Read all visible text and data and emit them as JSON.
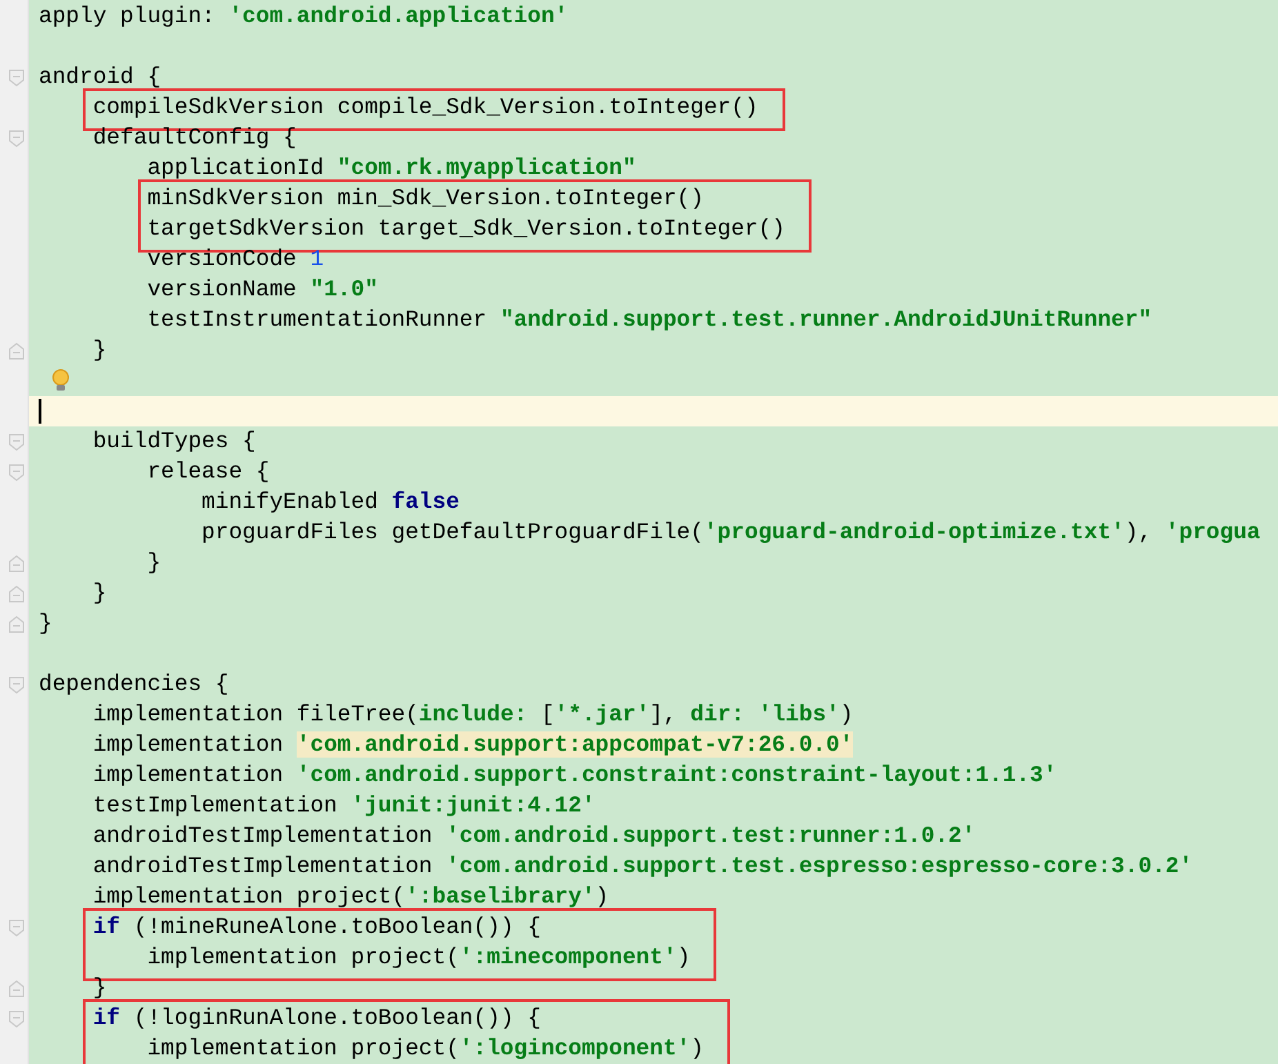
{
  "editor": {
    "blocks": [
      {
        "boxed": false,
        "lines": [
          {
            "tokens": [
              {
                "kind": "plain",
                "text": "apply plugin: "
              },
              {
                "kind": "string",
                "text": "'com.android.application'"
              }
            ]
          },
          {
            "kind": "blank"
          },
          {
            "fold_start": true,
            "tokens": [
              {
                "kind": "plain",
                "text": "android {"
              }
            ]
          }
        ]
      },
      {
        "boxed": true,
        "lines": [
          {
            "tokens": [
              {
                "kind": "plain",
                "text": "    compileSdkVersion compile_Sdk_Version.toInteger()"
              }
            ]
          }
        ]
      },
      {
        "boxed": false,
        "lines": [
          {
            "fold_start": true,
            "tokens": [
              {
                "kind": "plain",
                "text": "    defaultConfig {"
              }
            ]
          },
          {
            "tokens": [
              {
                "kind": "plain",
                "text": "        applicationId "
              },
              {
                "kind": "string",
                "text": "\"com.rk.myapplication\""
              }
            ]
          }
        ]
      },
      {
        "boxed": true,
        "lines": [
          {
            "tokens": [
              {
                "kind": "plain",
                "text": "        minSdkVersion min_Sdk_Version.toInteger()"
              }
            ]
          },
          {
            "tokens": [
              {
                "kind": "plain",
                "text": "        targetSdkVersion target_Sdk_Version.toInteger()"
              }
            ]
          }
        ]
      },
      {
        "boxed": false,
        "lines": [
          {
            "tokens": [
              {
                "kind": "plain",
                "text": "        versionCode "
              },
              {
                "kind": "number",
                "text": "1"
              }
            ]
          },
          {
            "tokens": [
              {
                "kind": "plain",
                "text": "        versionName "
              },
              {
                "kind": "string",
                "text": "\"1.0\""
              }
            ]
          },
          {
            "tokens": [
              {
                "kind": "plain",
                "text": "        testInstrumentationRunner "
              },
              {
                "kind": "string",
                "text": "\"android.support.test.runner.AndroidJUnitRunner\""
              }
            ]
          },
          {
            "fold_end": true,
            "tokens": [
              {
                "kind": "plain",
                "text": "    }"
              }
            ]
          },
          {
            "kind": "blank",
            "hint": true
          },
          {
            "kind": "blank",
            "current": true
          },
          {
            "fold_start": true,
            "tokens": [
              {
                "kind": "plain",
                "text": "    buildTypes {"
              }
            ]
          },
          {
            "fold_start": true,
            "tokens": [
              {
                "kind": "plain",
                "text": "        release {"
              }
            ]
          },
          {
            "tokens": [
              {
                "kind": "plain",
                "text": "            minifyEnabled "
              },
              {
                "kind": "keyword",
                "text": "false"
              }
            ]
          },
          {
            "tokens": [
              {
                "kind": "plain",
                "text": "            proguardFiles getDefaultProguardFile("
              },
              {
                "kind": "string",
                "text": "'proguard-android-optimize.txt'"
              },
              {
                "kind": "plain",
                "text": "), "
              },
              {
                "kind": "string",
                "text": "'progua"
              }
            ]
          },
          {
            "fold_end": true,
            "tokens": [
              {
                "kind": "plain",
                "text": "        }"
              }
            ]
          },
          {
            "fold_end": true,
            "tokens": [
              {
                "kind": "plain",
                "text": "    }"
              }
            ]
          },
          {
            "fold_end": true,
            "tokens": [
              {
                "kind": "plain",
                "text": "}"
              }
            ]
          },
          {
            "kind": "blank"
          },
          {
            "fold_start": true,
            "tokens": [
              {
                "kind": "plain",
                "text": "dependencies {"
              }
            ]
          },
          {
            "tokens": [
              {
                "kind": "plain",
                "text": "    implementation fileTree("
              },
              {
                "kind": "string",
                "text": "include: "
              },
              {
                "kind": "plain",
                "text": "["
              },
              {
                "kind": "string",
                "text": "'*.jar'"
              },
              {
                "kind": "plain",
                "text": "], "
              },
              {
                "kind": "string",
                "text": "dir: 'libs'"
              },
              {
                "kind": "plain",
                "text": ")"
              }
            ]
          },
          {
            "tokens": [
              {
                "kind": "plain",
                "text": "    implementation "
              },
              {
                "kind": "string",
                "text": "'com.android.support:appcompat-v7:26.0.0'",
                "marked": true
              }
            ]
          },
          {
            "tokens": [
              {
                "kind": "plain",
                "text": "    implementation "
              },
              {
                "kind": "string",
                "text": "'com.android.support.constraint:constraint-layout:1.1.3'"
              }
            ]
          },
          {
            "tokens": [
              {
                "kind": "plain",
                "text": "    testImplementation "
              },
              {
                "kind": "string",
                "text": "'junit:junit:4.12'"
              }
            ]
          },
          {
            "tokens": [
              {
                "kind": "plain",
                "text": "    androidTestImplementation "
              },
              {
                "kind": "string",
                "text": "'com.android.support.test:runner:1.0.2'"
              }
            ]
          },
          {
            "tokens": [
              {
                "kind": "plain",
                "text": "    androidTestImplementation "
              },
              {
                "kind": "string",
                "text": "'com.android.support.test.espresso:espresso-core:3.0.2'"
              }
            ]
          },
          {
            "tokens": [
              {
                "kind": "plain",
                "text": "    implementation project("
              },
              {
                "kind": "string",
                "text": "':baselibrary'"
              },
              {
                "kind": "plain",
                "text": ")"
              }
            ]
          }
        ]
      },
      {
        "boxed": true,
        "lines": [
          {
            "fold_start": true,
            "tokens": [
              {
                "kind": "keyword",
                "text": "    if"
              },
              {
                "kind": "plain",
                "text": " (!mineRuneAlone.toBoolean()) {"
              }
            ]
          },
          {
            "tokens": [
              {
                "kind": "plain",
                "text": "        implementation project("
              },
              {
                "kind": "string",
                "text": "':minecomponent'"
              },
              {
                "kind": "plain",
                "text": ")"
              }
            ]
          }
        ]
      },
      {
        "boxed": false,
        "lines": [
          {
            "fold_end": true,
            "tokens": [
              {
                "kind": "plain",
                "text": "    }"
              }
            ]
          }
        ]
      },
      {
        "boxed": true,
        "lines": [
          {
            "fold_start": true,
            "tokens": [
              {
                "kind": "keyword",
                "text": "    if"
              },
              {
                "kind": "plain",
                "text": " (!loginRunAlone.toBoolean()) {"
              }
            ]
          },
          {
            "tokens": [
              {
                "kind": "plain",
                "text": "        implementation project("
              },
              {
                "kind": "string",
                "text": "':logincomponent'"
              },
              {
                "kind": "plain",
                "text": ")"
              }
            ]
          }
        ]
      }
    ]
  }
}
